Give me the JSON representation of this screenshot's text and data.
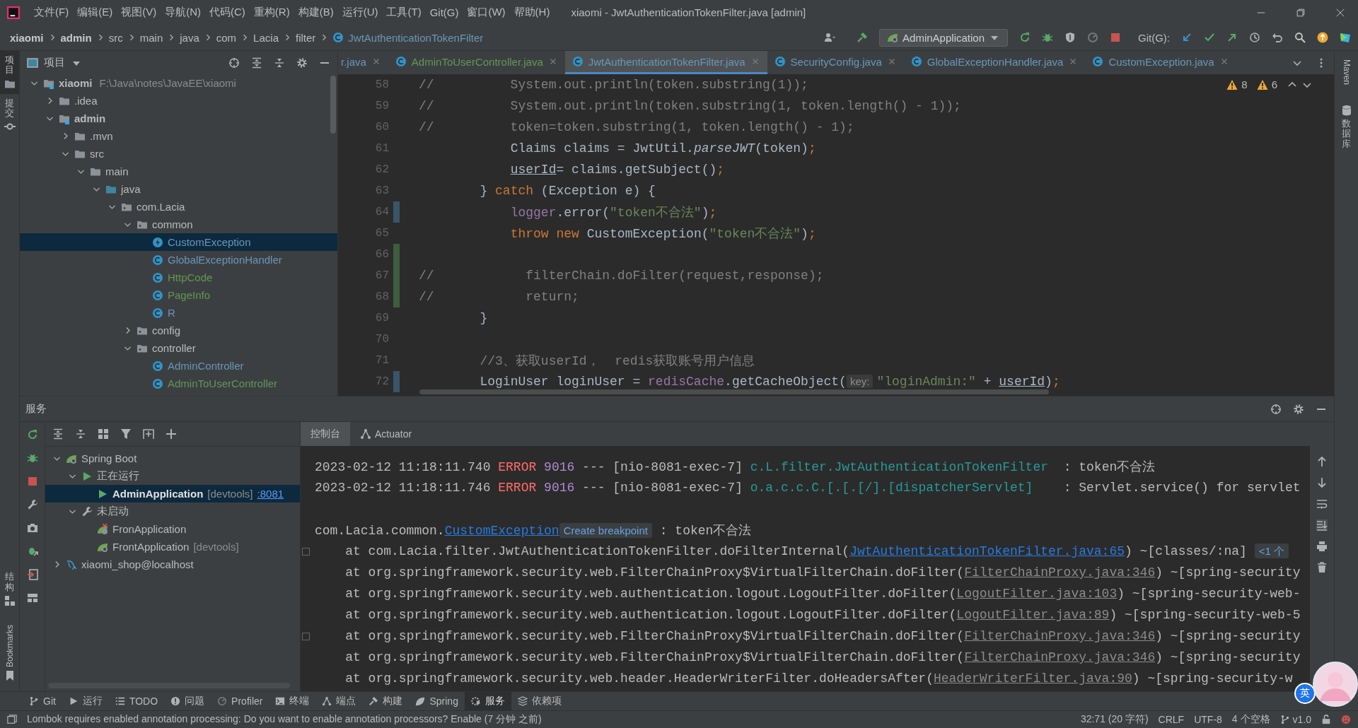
{
  "menu": [
    "文件(F)",
    "编辑(E)",
    "视图(V)",
    "导航(N)",
    "代码(C)",
    "重构(R)",
    "构建(B)",
    "运行(U)",
    "工具(T)",
    "Git(G)",
    "窗口(W)",
    "帮助(H)"
  ],
  "window_title": "xiaomi - JwtAuthenticationTokenFilter.java [admin]",
  "breadcrumbs": [
    {
      "label": "xiaomi",
      "kind": "module"
    },
    {
      "label": "admin",
      "kind": "module"
    },
    {
      "label": "src",
      "kind": "folder"
    },
    {
      "label": "main",
      "kind": "folder"
    },
    {
      "label": "java",
      "kind": "folder"
    },
    {
      "label": "com",
      "kind": "folder"
    },
    {
      "label": "Lacia",
      "kind": "folder"
    },
    {
      "label": "filter",
      "kind": "folder"
    },
    {
      "label": "JwtAuthenticationTokenFilter",
      "kind": "class"
    }
  ],
  "run_config": "AdminApplication",
  "git_label": "Git(G):",
  "left_stripe": {
    "top": [
      {
        "label": "项目",
        "selected": true
      },
      {
        "label": "提交",
        "selected": false
      }
    ],
    "bottom": [
      "结构",
      "Bookmarks"
    ]
  },
  "right_stripe": [
    "Maven",
    "数据库"
  ],
  "project": {
    "title": "项目",
    "tree": [
      {
        "label": "xiaomi",
        "kind": "module",
        "path": "F:\\Java\\notes\\JavaEE\\xiaomi",
        "expanded": true,
        "selected": false,
        "children": [
          {
            "label": ".idea",
            "kind": "folder",
            "expanded": false,
            "selected": false
          },
          {
            "label": "admin",
            "kind": "module",
            "expanded": true,
            "selected": false,
            "children": [
              {
                "label": ".mvn",
                "kind": "folder",
                "expanded": false,
                "selected": false
              },
              {
                "label": "src",
                "kind": "folder",
                "expanded": true,
                "selected": false,
                "children": [
                  {
                    "label": "main",
                    "kind": "folder",
                    "expanded": true,
                    "selected": false,
                    "children": [
                      {
                        "label": "java",
                        "kind": "source",
                        "expanded": true,
                        "selected": false,
                        "children": [
                          {
                            "label": "com.Lacia",
                            "kind": "package",
                            "expanded": true,
                            "selected": false,
                            "children": [
                              {
                                "label": "common",
                                "kind": "package",
                                "expanded": true,
                                "selected": false,
                                "children": [
                                  {
                                    "label": "CustomException",
                                    "kind": "exception",
                                    "color": "#6897bb",
                                    "selected": true
                                  },
                                  {
                                    "label": "GlobalExceptionHandler",
                                    "kind": "class",
                                    "color": "#6897bb",
                                    "selected": false
                                  },
                                  {
                                    "label": "HttpCode",
                                    "kind": "class",
                                    "color": "#629755",
                                    "selected": false
                                  },
                                  {
                                    "label": "PageInfo",
                                    "kind": "class",
                                    "color": "#629755",
                                    "selected": false
                                  },
                                  {
                                    "label": "R",
                                    "kind": "class",
                                    "color": "#6897bb",
                                    "selected": false
                                  }
                                ]
                              },
                              {
                                "label": "config",
                                "kind": "package",
                                "expanded": false,
                                "selected": false
                              },
                              {
                                "label": "controller",
                                "kind": "package",
                                "expanded": true,
                                "selected": false,
                                "children": [
                                  {
                                    "label": "AdminController",
                                    "kind": "class",
                                    "color": "#6897bb",
                                    "selected": false
                                  },
                                  {
                                    "label": "AdminToUserController",
                                    "kind": "class",
                                    "color": "#629755",
                                    "selected": false
                                  }
                                ]
                              }
                            ]
                          }
                        ]
                      }
                    ]
                  }
                ]
              }
            ]
          }
        ]
      }
    ]
  },
  "editor": {
    "tabs": [
      {
        "label": "r.java",
        "color": "#6897bb",
        "selected": false
      },
      {
        "label": "AdminToUserController.java",
        "color": "#629755",
        "selected": false
      },
      {
        "label": "JwtAuthenticationTokenFilter.java",
        "color": "#6897bb",
        "selected": true
      },
      {
        "label": "SecurityConfig.java",
        "color": "#6897bb",
        "selected": false
      },
      {
        "label": "GlobalExceptionHandler.java",
        "color": "#6897bb",
        "selected": false
      },
      {
        "label": "CustomException.java",
        "color": "#6897bb",
        "selected": false
      }
    ],
    "warnings": [
      "8",
      "6"
    ],
    "lines": [
      {
        "number": "58",
        "segments": [
          {
            "kind": "comment",
            "text": "//          System.out.println(token.substring(1));"
          }
        ]
      },
      {
        "number": "59",
        "segments": [
          {
            "kind": "comment",
            "text": "//          System.out.println(token.substring(1, token.length() - 1));"
          }
        ]
      },
      {
        "number": "60",
        "segments": [
          {
            "kind": "comment",
            "text": "//          token=token.substring(1, token.length() - 1);"
          }
        ]
      },
      {
        "number": "61",
        "segments": [
          {
            "kind": "plain",
            "text": "            Claims claims = JwtUtil."
          },
          {
            "kind": "italic",
            "text": "parseJWT"
          },
          {
            "kind": "plain",
            "text": "(token)"
          },
          {
            "kind": "keyword",
            "text": ";"
          }
        ]
      },
      {
        "number": "62",
        "segments": [
          {
            "kind": "underline",
            "text": "            userId"
          },
          {
            "kind": "plain",
            "text": "= claims.getSubject()"
          },
          {
            "kind": "keyword",
            "text": ";"
          }
        ]
      },
      {
        "number": "63",
        "segments": [
          {
            "kind": "plain",
            "text": "        } "
          },
          {
            "kind": "keyword",
            "text": "catch"
          },
          {
            "kind": "plain",
            "text": " (Exception e) {"
          }
        ]
      },
      {
        "number": "64",
        "color": "#3a5468",
        "segments": [
          {
            "kind": "field",
            "text": "            logger"
          },
          {
            "kind": "plain",
            "text": ".error("
          },
          {
            "kind": "string",
            "text": "\"token不合法\""
          },
          {
            "kind": "plain",
            "text": ")"
          },
          {
            "kind": "keyword",
            "text": ";"
          }
        ]
      },
      {
        "number": "65",
        "segments": [
          {
            "kind": "keyword",
            "text": "            throw new"
          },
          {
            "kind": "plain",
            "text": " CustomException("
          },
          {
            "kind": "string",
            "text": "\"token不合法\""
          },
          {
            "kind": "plain",
            "text": ")"
          },
          {
            "kind": "keyword",
            "text": ";"
          }
        ]
      },
      {
        "number": "66",
        "color": "#3f5c3f"
      },
      {
        "number": "67",
        "color": "#3f5c3f",
        "segments": [
          {
            "kind": "comment",
            "text": "//            filterChain.doFilter(request,response);"
          }
        ]
      },
      {
        "number": "68",
        "color": "#3f5c3f",
        "segments": [
          {
            "kind": "comment",
            "text": "//            return;"
          }
        ]
      },
      {
        "number": "69",
        "segments": [
          {
            "kind": "plain",
            "text": "        }"
          }
        ]
      },
      {
        "number": "70"
      },
      {
        "number": "71",
        "segments": [
          {
            "kind": "comment",
            "text": "        //3、获取userId，  redis获取账号用户信息"
          }
        ]
      },
      {
        "number": "72",
        "color": "#3a5468",
        "segments": [
          {
            "kind": "plain",
            "text": "        LoginUser loginUser = "
          },
          {
            "kind": "field",
            "text": "redisCache"
          },
          {
            "kind": "plain",
            "text": ".getCacheObject("
          },
          {
            "kind": "hint",
            "text": "key:"
          },
          {
            "kind": "string",
            "text": "\"loginAdmin:\""
          },
          {
            "kind": "plain",
            "text": " + "
          },
          {
            "kind": "underline",
            "text": "userId"
          },
          {
            "kind": "plain",
            "text": ")"
          },
          {
            "kind": "keyword",
            "text": ";"
          }
        ]
      }
    ]
  },
  "services": {
    "title": "服务",
    "tree": [
      {
        "label": "Spring Boot",
        "kind": "spring",
        "expanded": true,
        "selected": false,
        "children": [
          {
            "label": "正在运行",
            "kind": "running",
            "expanded": true,
            "selected": false,
            "children": [
              {
                "label": "AdminApplication",
                "kind": "app-running",
                "tag": "[devtools]",
                "link": ":8081",
                "selected": true
              }
            ]
          },
          {
            "label": "未启动",
            "kind": "stopped",
            "expanded": true,
            "selected": false,
            "children": [
              {
                "label": "FronApplication",
                "kind": "app-error",
                "selected": false
              },
              {
                "label": "FrontApplication",
                "kind": "app",
                "tag": "[devtools]",
                "selected": false
              }
            ]
          }
        ]
      },
      {
        "label": "xiaomi_shop@localhost",
        "kind": "database",
        "expanded": false,
        "selected": false
      }
    ]
  },
  "console": {
    "tabs": [
      {
        "label": "控制台",
        "selected": true
      },
      {
        "label": "Actuator",
        "selected": false
      }
    ],
    "lines": [
      {
        "fold": false,
        "segments": [
          {
            "kind": "plain",
            "text": "2023-02-12 11:18:11.740 "
          },
          {
            "kind": "error",
            "text": "ERROR"
          },
          {
            "kind": "pid",
            "text": " 9016"
          },
          {
            "kind": "plain",
            "text": " --- [nio-8081-exec-7] "
          },
          {
            "kind": "logger",
            "text": "c.L.filter.JwtAuthenticationTokenFilter"
          },
          {
            "kind": "plain",
            "text": "  : token不合法"
          }
        ]
      },
      {
        "fold": false,
        "segments": [
          {
            "kind": "plain",
            "text": "2023-02-12 11:18:11.746 "
          },
          {
            "kind": "error",
            "text": "ERROR"
          },
          {
            "kind": "pid",
            "text": " 9016"
          },
          {
            "kind": "plain",
            "text": " --- [nio-8081-exec-7] "
          },
          {
            "kind": "logger",
            "text": "o.a.c.c.C.[.[.[/].[dispatcherServlet]"
          },
          {
            "kind": "plain",
            "text": "    : Servlet.service() for servlet"
          }
        ]
      },
      {
        "fold": false
      },
      {
        "fold": false,
        "segments": [
          {
            "kind": "plain",
            "text": "com.Lacia.common."
          },
          {
            "kind": "link",
            "text": "CustomException"
          },
          {
            "kind": "hint",
            "text": "Create breakpoint"
          },
          {
            "kind": "plain",
            "text": " : token不合法"
          }
        ]
      },
      {
        "fold": true,
        "segments": [
          {
            "kind": "plain",
            "text": "    at com.Lacia.filter.JwtAuthenticationTokenFilter.doFilterInternal("
          },
          {
            "kind": "link",
            "text": "JwtAuthenticationTokenFilter.java:65"
          },
          {
            "kind": "plain",
            "text": ") ~[classes/:na] "
          },
          {
            "kind": "hint",
            "text": "<1 个"
          }
        ]
      },
      {
        "fold": false,
        "segments": [
          {
            "kind": "plain",
            "text": "    at org.springframework.security.web.FilterChainProxy$VirtualFilterChain.doFilter("
          },
          {
            "kind": "dim-link",
            "text": "FilterChainProxy.java:346"
          },
          {
            "kind": "plain",
            "text": ") ~[spring-security"
          }
        ]
      },
      {
        "fold": false,
        "segments": [
          {
            "kind": "plain",
            "text": "    at org.springframework.security.web.authentication.logout.LogoutFilter.doFilter("
          },
          {
            "kind": "dim-link",
            "text": "LogoutFilter.java:103"
          },
          {
            "kind": "plain",
            "text": ") ~[spring-security-web-"
          }
        ]
      },
      {
        "fold": false,
        "segments": [
          {
            "kind": "plain",
            "text": "    at org.springframework.security.web.authentication.logout.LogoutFilter.doFilter("
          },
          {
            "kind": "dim-link",
            "text": "LogoutFilter.java:89"
          },
          {
            "kind": "plain",
            "text": ") ~[spring-security-web-5"
          }
        ]
      },
      {
        "fold": true,
        "segments": [
          {
            "kind": "plain",
            "text": "    at org.springframework.security.web.FilterChainProxy$VirtualFilterChain.doFilter("
          },
          {
            "kind": "dim-link",
            "text": "FilterChainProxy.java:346"
          },
          {
            "kind": "plain",
            "text": ") ~[spring-security"
          }
        ]
      },
      {
        "fold": false,
        "segments": [
          {
            "kind": "plain",
            "text": "    at org.springframework.security.web.FilterChainProxy$VirtualFilterChain.doFilter("
          },
          {
            "kind": "dim-link",
            "text": "FilterChainProxy.java:346"
          },
          {
            "kind": "plain",
            "text": ") ~[spring-security"
          }
        ]
      },
      {
        "fold": false,
        "segments": [
          {
            "kind": "plain",
            "text": "    at org.springframework.security.web.header.HeaderWriterFilter.doHeadersAfter("
          },
          {
            "kind": "dim-link",
            "text": "HeaderWriterFilter.java:90"
          },
          {
            "kind": "plain",
            "text": ") ~[spring-security-w"
          }
        ]
      }
    ]
  },
  "tool_windows": [
    {
      "label": "Git",
      "selected": false
    },
    {
      "label": "运行",
      "selected": false
    },
    {
      "label": "TODO",
      "selected": false
    },
    {
      "label": "问题",
      "selected": false
    },
    {
      "label": "Profiler",
      "selected": false
    },
    {
      "label": "终端",
      "selected": false
    },
    {
      "label": "端点",
      "selected": false
    },
    {
      "label": "构建",
      "selected": false
    },
    {
      "label": "Spring",
      "selected": false
    },
    {
      "label": "服务",
      "selected": true
    },
    {
      "label": "依赖项",
      "selected": false
    }
  ],
  "ime_badge": "英",
  "status": {
    "message": "Lombok requires enabled annotation processing: Do you want to enable annotation processors? Enable (7 分钟 之前)",
    "items": [
      "32:71 (20 字符)",
      "CRLF",
      "UTF-8",
      "4 个空格"
    ],
    "branch": "v1.0"
  }
}
